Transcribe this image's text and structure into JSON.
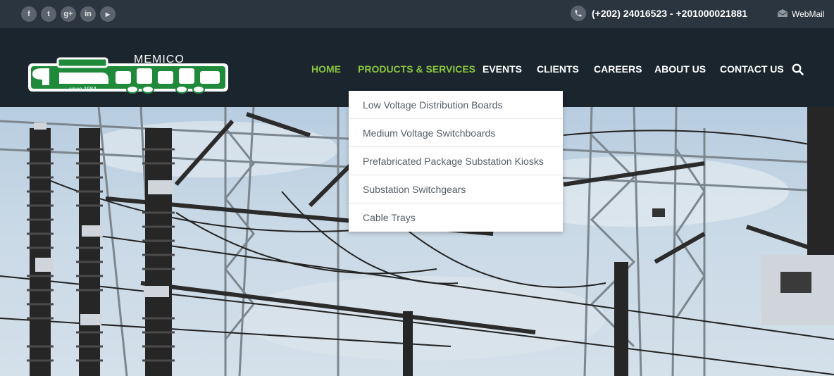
{
  "topbar": {
    "social": [
      {
        "icon": "facebook-icon",
        "glyph": "f"
      },
      {
        "icon": "twitter-icon",
        "glyph": "t"
      },
      {
        "icon": "google-plus-icon",
        "glyph": "g+"
      },
      {
        "icon": "linkedin-icon",
        "glyph": "in"
      },
      {
        "icon": "youtube-icon",
        "glyph": "▶"
      }
    ],
    "phone": "(+202) 24016523 - +201000021881",
    "webmail": "WebMail"
  },
  "logo": {
    "brand": "MEMICO",
    "tagline": "since 1984"
  },
  "nav": {
    "items": [
      {
        "label": "HOME",
        "active": true
      },
      {
        "label": "PRODUCTS & SERVICES",
        "active": true
      },
      {
        "label": "EVENTS",
        "active": false
      },
      {
        "label": "CLIENTS",
        "active": false
      },
      {
        "label": "CAREERS",
        "active": false
      },
      {
        "label": "ABOUT US",
        "active": false
      },
      {
        "label": "CONTACT US",
        "active": false
      }
    ]
  },
  "dropdown": {
    "items": [
      "Low Voltage Distribution Boards",
      "Medium Voltage Switchboards",
      "Prefabricated Package Substation Kiosks",
      "Substation Switchgears",
      "Cable Trays"
    ]
  },
  "colors": {
    "accent": "#8bc53f",
    "topbar": "#2b3540",
    "header": "#1b252e"
  }
}
